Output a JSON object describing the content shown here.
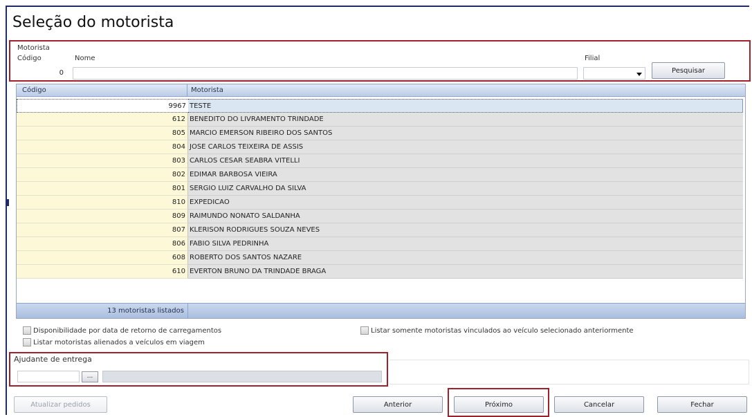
{
  "window": {
    "title": "Seleção do motorista"
  },
  "search": {
    "group_label": "Motorista",
    "code_label": "Código",
    "code_value": "0",
    "name_label": "Nome",
    "name_value": "",
    "filial_label": "Filial",
    "filial_value": "",
    "search_button": "Pesquisar"
  },
  "grid": {
    "columns": [
      "Código",
      "Motorista"
    ],
    "rows": [
      {
        "code": "9967",
        "name": "TESTE"
      },
      {
        "code": "612",
        "name": "BENEDITO DO LIVRAMENTO TRINDADE"
      },
      {
        "code": "805",
        "name": "MARCIO EMERSON RIBEIRO DOS SANTOS"
      },
      {
        "code": "804",
        "name": "JOSE CARLOS TEIXEIRA DE ASSIS"
      },
      {
        "code": "803",
        "name": "CARLOS CESAR SEABRA VITELLI"
      },
      {
        "code": "802",
        "name": "EDIMAR BARBOSA VIEIRA"
      },
      {
        "code": "801",
        "name": "SERGIO LUIZ CARVALHO DA SILVA"
      },
      {
        "code": "810",
        "name": "EXPEDICAO"
      },
      {
        "code": "809",
        "name": "RAIMUNDO NONATO SALDANHA"
      },
      {
        "code": "807",
        "name": "KLERISON RODRIGUES SOUZA NEVES"
      },
      {
        "code": "806",
        "name": "FABIO SILVA PEDRINHA"
      },
      {
        "code": "608",
        "name": "ROBERTO DOS SANTOS NAZARE"
      },
      {
        "code": "610",
        "name": "EVERTON BRUNO DA TRINDADE BRAGA"
      }
    ],
    "footer_count": "13 motoristas listados"
  },
  "options": {
    "availability": "Disponibilidade por data de retorno de carregamentos",
    "linked_only": "Listar somente motoristas vinculados ao veículo selecionado anteriormente",
    "allocated": "Listar motoristas alienados a veículos em viagem"
  },
  "helper": {
    "label": "Ajudante de entrega",
    "lookup_button": "..."
  },
  "buttons": {
    "update_orders": "Atualizar pedidos",
    "previous": "Anterior",
    "next": "Próximo",
    "cancel": "Cancelar",
    "close": "Fechar"
  }
}
